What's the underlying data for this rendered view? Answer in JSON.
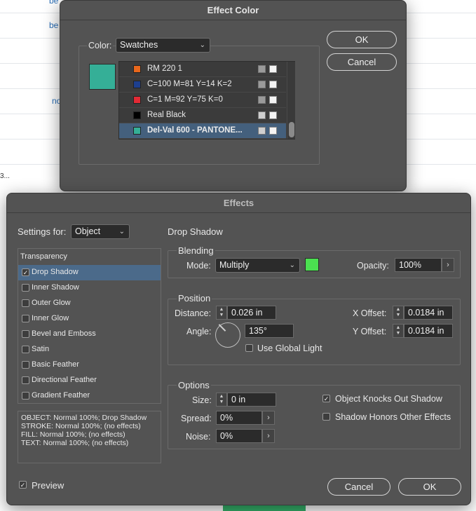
{
  "background": {
    "fragments": [
      "be",
      "be",
      "no",
      "3..."
    ]
  },
  "effect_color": {
    "title": "Effect Color",
    "color_label": "Color:",
    "color_mode": "Swatches",
    "preview_color": "#35af97",
    "swatches": [
      {
        "name": "RM 220 1",
        "color": "#e8671c",
        "selected": false
      },
      {
        "name": "C=100 M=81 Y=14 K=2",
        "color": "#1d3f8f",
        "selected": false
      },
      {
        "name": "C=1 M=92 Y=75 K=0",
        "color": "#e32a35",
        "selected": false
      },
      {
        "name": "Real Black",
        "color": "#000000",
        "selected": false
      },
      {
        "name": "Del-Val 600 - PANTONE...",
        "color": "#35af97",
        "selected": true
      }
    ],
    "ok_label": "OK",
    "cancel_label": "Cancel"
  },
  "effects": {
    "title": "Effects",
    "settings_for_label": "Settings for:",
    "settings_for_value": "Object",
    "list_header": "Transparency",
    "items": [
      {
        "label": "Drop Shadow",
        "checked": true,
        "selected": true
      },
      {
        "label": "Inner Shadow",
        "checked": false,
        "selected": false
      },
      {
        "label": "Outer Glow",
        "checked": false,
        "selected": false
      },
      {
        "label": "Inner Glow",
        "checked": false,
        "selected": false
      },
      {
        "label": "Bevel and Emboss",
        "checked": false,
        "selected": false
      },
      {
        "label": "Satin",
        "checked": false,
        "selected": false
      },
      {
        "label": "Basic Feather",
        "checked": false,
        "selected": false
      },
      {
        "label": "Directional Feather",
        "checked": false,
        "selected": false
      },
      {
        "label": "Gradient Feather",
        "checked": false,
        "selected": false
      }
    ],
    "summary": [
      "OBJECT: Normal 100%; Drop Shadow",
      "STROKE: Normal 100%; (no effects)",
      "FILL: Normal 100%; (no effects)",
      "TEXT: Normal 100%; (no effects)"
    ],
    "section_title": "Drop Shadow",
    "blending": {
      "title": "Blending",
      "mode_label": "Mode:",
      "mode_value": "Multiply",
      "swatch_color": "#4be050",
      "opacity_label": "Opacity:",
      "opacity_value": "100%"
    },
    "position": {
      "title": "Position",
      "distance_label": "Distance:",
      "distance_value": "0.026 in",
      "angle_label": "Angle:",
      "angle_value": "135°",
      "use_global_light_label": "Use Global Light",
      "use_global_light": false,
      "x_offset_label": "X Offset:",
      "x_offset_value": "0.0184 in",
      "y_offset_label": "Y Offset:",
      "y_offset_value": "0.0184 in"
    },
    "options": {
      "title": "Options",
      "size_label": "Size:",
      "size_value": "0 in",
      "spread_label": "Spread:",
      "spread_value": "0%",
      "noise_label": "Noise:",
      "noise_value": "0%",
      "knocks_out_label": "Object Knocks Out Shadow",
      "knocks_out": true,
      "honors_label": "Shadow Honors Other Effects",
      "honors": false
    },
    "preview_label": "Preview",
    "preview": true,
    "cancel_label": "Cancel",
    "ok_label": "OK"
  }
}
